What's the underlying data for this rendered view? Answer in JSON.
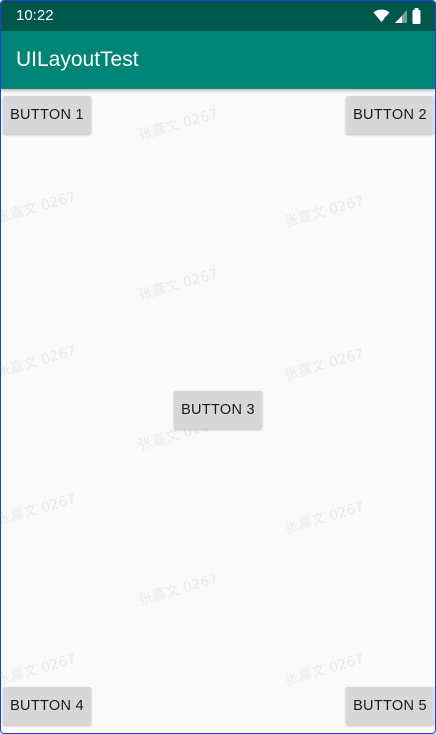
{
  "status_bar": {
    "time": "10:22",
    "icons": [
      "wifi-icon",
      "cellular-signal-icon",
      "battery-icon"
    ],
    "background": "#00574b"
  },
  "app_bar": {
    "title": "UILayoutTest",
    "background": "#008577"
  },
  "buttons": [
    {
      "label": "BUTTON 1"
    },
    {
      "label": "BUTTON 2"
    },
    {
      "label": "BUTTON 3"
    },
    {
      "label": "BUTTON 4"
    },
    {
      "label": "BUTTON 5"
    }
  ],
  "watermark": "张嘉文 0267",
  "colors": {
    "content_background": "#fafafa",
    "button_background": "#d6d7d7"
  }
}
